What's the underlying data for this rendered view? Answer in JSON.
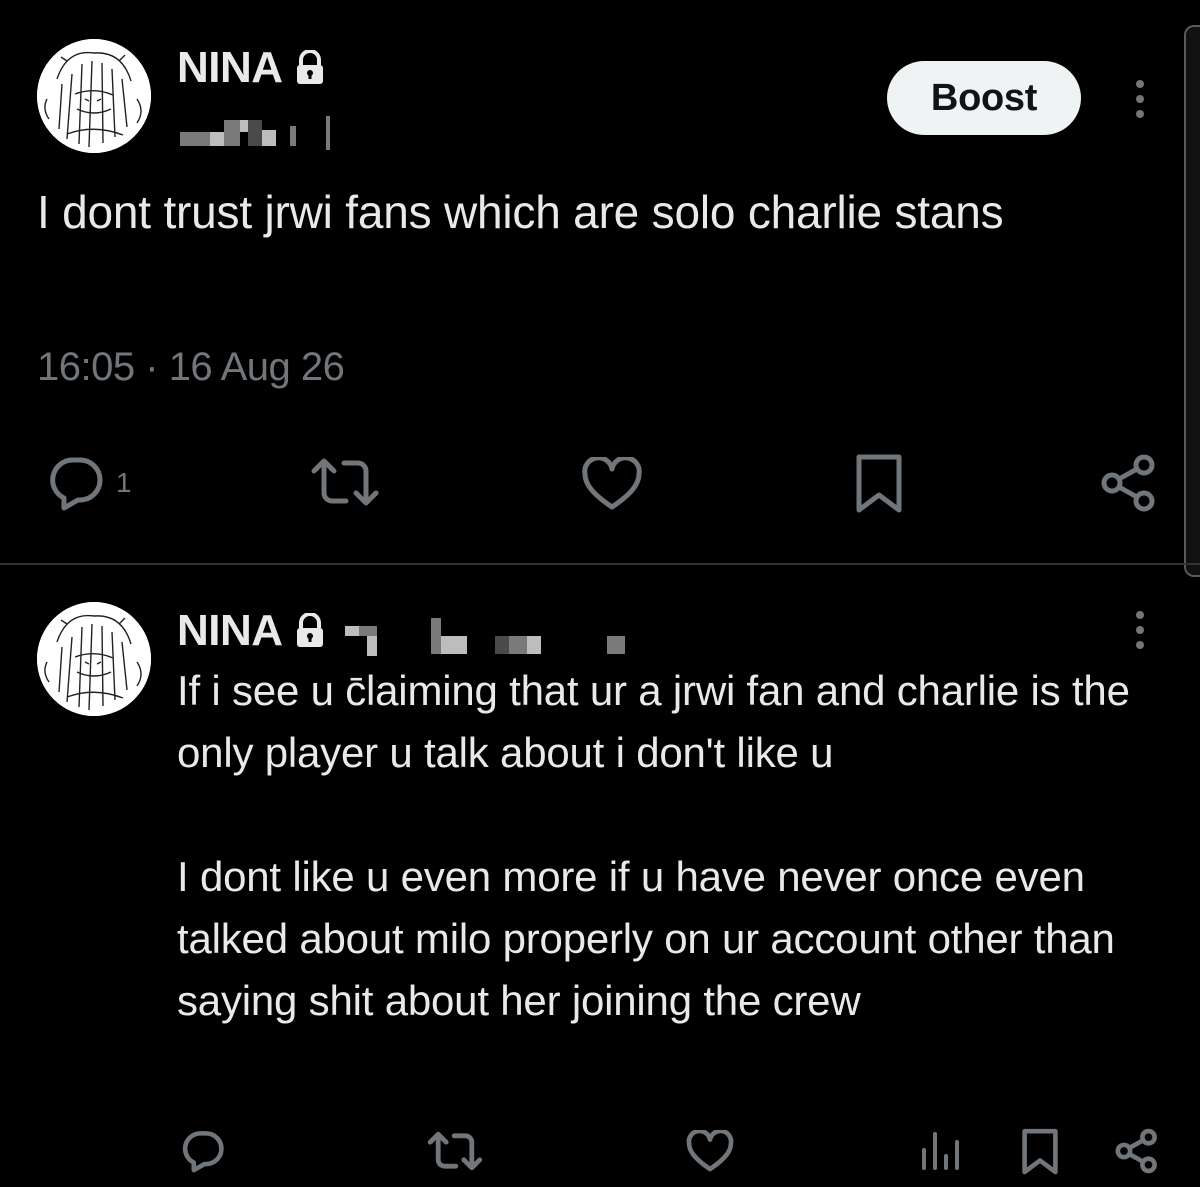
{
  "main_post": {
    "author_name": "NINA",
    "boost_label": "Boost",
    "text": "I dont trust jrwi fans which are solo charlie stans",
    "time": "16:05",
    "separator": "·",
    "date": "16 Aug 26",
    "reply_count": "1"
  },
  "reply_post": {
    "author_name": "NINA",
    "paragraphs": [
      "If i see u c̄laiming that ur a jrwi fan and charlie is the only player u talk about i don't like u",
      "I dont like u even more if u have never once even talked about milo properly on ur account other than saying shit about her joining the crew"
    ]
  },
  "icons": {
    "lock": "lock-icon",
    "more": "more-vertical-icon",
    "reply": "reply-icon",
    "repost": "repost-icon",
    "like": "heart-icon",
    "bookmark": "bookmark-icon",
    "share": "share-icon",
    "analytics": "analytics-icon"
  },
  "colors": {
    "background": "#000000",
    "text": "#e7e9ea",
    "secondary": "#71767b",
    "button_bg": "#eff3f4"
  }
}
